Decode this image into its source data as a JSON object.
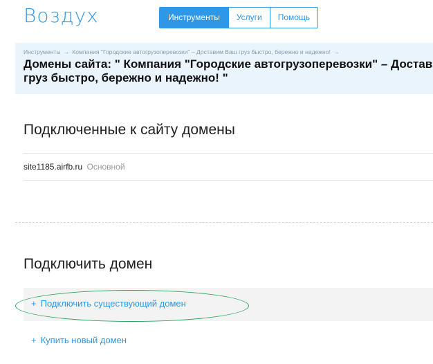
{
  "header": {
    "logo": "Воздух",
    "nav": [
      {
        "label": "Инструменты",
        "active": true
      },
      {
        "label": "Услуги",
        "active": false
      },
      {
        "label": "Помощь",
        "active": false
      }
    ]
  },
  "breadcrumb": {
    "items": [
      "Инструменты",
      "Компания \"Городские автогрузоперевозки\" – Доставим Ваш груз быстро, бережно и надежно!"
    ],
    "separator": "→"
  },
  "page": {
    "title_line1": "Домены сайта: \" Компания \"Городские автогрузоперевозки\" – Доставим Ваш",
    "title_line2": "груз быстро, бережно и надежно! \""
  },
  "connected": {
    "heading": "Подключенные к сайту домены",
    "domain": "site1185.airfb.ru",
    "badge": "Основной"
  },
  "connect": {
    "heading": "Подключить домен",
    "actions": [
      {
        "plus": "+",
        "label": "Подключить существующий домен"
      },
      {
        "plus": "+",
        "label": "Купить новый домен"
      }
    ]
  },
  "colors": {
    "accent": "#2f97e6",
    "hero_bg": "#eaf4fc",
    "highlight": "#2aa45a"
  }
}
